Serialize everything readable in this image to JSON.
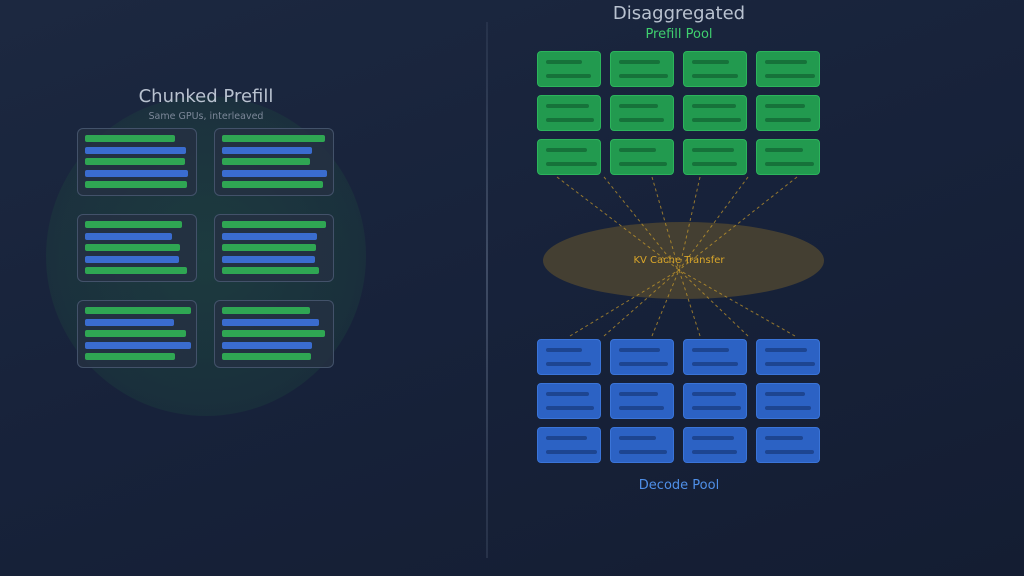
{
  "left": {
    "title": "Chunked Prefill",
    "subtitle": "Same GPUs, interleaved",
    "boxes": [
      [
        "prefill",
        "decode",
        "prefill",
        "decode",
        "prefill"
      ],
      [
        "prefill",
        "decode",
        "prefill",
        "decode",
        "prefill"
      ],
      [
        "prefill",
        "decode",
        "prefill",
        "decode",
        "prefill"
      ],
      [
        "prefill",
        "decode",
        "prefill",
        "decode",
        "prefill"
      ],
      [
        "prefill",
        "decode",
        "prefill",
        "decode",
        "prefill"
      ],
      [
        "prefill",
        "decode",
        "prefill",
        "decode",
        "prefill"
      ]
    ]
  },
  "right": {
    "title": "Disaggregated",
    "prefill_pool_label": "Prefill Pool",
    "transfer_label": "KV Cache Transfer",
    "decode_pool_label": "Decode Pool",
    "prefill_rows": 3,
    "decode_rows": 3,
    "columns": 4
  },
  "colors": {
    "prefill": "#2fa653",
    "decode": "#3a6ccf",
    "transfer": "#d9a62a",
    "title": "#b9c2d0",
    "prefill_label": "#3fcf6f",
    "decode_label": "#4f8fe8"
  }
}
